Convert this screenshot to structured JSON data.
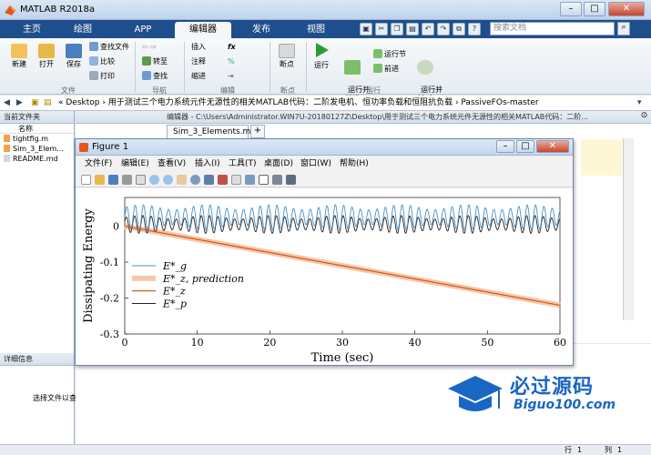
{
  "window": {
    "title": "MATLAB R2018a"
  },
  "tabs": [
    "主页",
    "绘图",
    "APP",
    "编辑器",
    "发布",
    "视图"
  ],
  "search": {
    "placeholder": "搜索文档"
  },
  "ribbon": {
    "file": {
      "new": "新建",
      "open": "打开",
      "save": "保存",
      "find_files": "查找文件",
      "compare": "比较",
      "print": "打印",
      "label": "文件"
    },
    "nav": {
      "goto": "转至",
      "find": "查找",
      "label": "导航"
    },
    "edit": {
      "insert": "插入",
      "comment": "注释",
      "indent": "缩进",
      "fx": "fx",
      "label": "编辑"
    },
    "breakpoints": {
      "label": "断点",
      "btn": "断点"
    },
    "run": {
      "run": "运行",
      "run_advance": "运行并\n前进",
      "run_section": "运行节",
      "advance": "前进",
      "run_time": "运行并\n计时",
      "label": "运行"
    }
  },
  "address": {
    "path": "« Desktop › 用于测试三个电力系统元件无源性的相关MATLAB代码：二阶发电机、恒功率负载和恒阻抗负载 › PassiveFOs-master"
  },
  "current_folder": {
    "title": "当前文件夹",
    "column": "名称",
    "files": [
      "tightfig.m",
      "Sim_3_Elem...",
      "README.md"
    ]
  },
  "details": {
    "title": "详细信息",
    "hint": "选择文件以查看详细信息"
  },
  "editor": {
    "header": "编辑器 - C:\\Users\\Administrator.WIN7U-20180127Z\\Desktop\\用于测试三个电力系统元件无源性的相关MATLAB代码：二阶...",
    "tab": "Sim_3_Elements.m",
    "add_tab": "+"
  },
  "status": {
    "row_label": "行",
    "row": "1",
    "col_label": "列",
    "col": "1"
  },
  "figure": {
    "title": "Figure 1",
    "menu": [
      "文件(F)",
      "编辑(E)",
      "查看(V)",
      "插入(I)",
      "工具(T)",
      "桌面(D)",
      "窗口(W)",
      "帮助(H)"
    ]
  },
  "chart_data": {
    "type": "line",
    "xlabel": "Time (sec)",
    "ylabel": "Dissipating Energy",
    "xlim": [
      0,
      60
    ],
    "ylim": [
      -0.3,
      0.08
    ],
    "xticks": [
      0,
      10,
      20,
      30,
      40,
      50,
      60
    ],
    "yticks": [
      0,
      -0.1,
      -0.2,
      -0.3
    ],
    "legend": [
      "E*_g",
      "E*_z, prediction",
      "E*_z",
      "E*_p"
    ],
    "legend_position": "bottom-left",
    "series": [
      {
        "name": "E*_g",
        "color": "#4a90c8",
        "description": "oscillating",
        "amplitude": 0.035,
        "center": 0.025,
        "period_sec": 1.15,
        "x": [
          0,
          60
        ],
        "y_range": [
          -0.04,
          0.08
        ]
      },
      {
        "name": "E*_z, prediction",
        "color": "#f4c9a8",
        "x": [
          0,
          60
        ],
        "y": [
          0,
          -0.22
        ]
      },
      {
        "name": "E*_z",
        "color": "#d95319",
        "x": [
          0,
          60
        ],
        "y": [
          0,
          -0.22
        ]
      },
      {
        "name": "E*_p",
        "color": "#222222",
        "description": "oscillating",
        "amplitude": 0.025,
        "center": 0.005,
        "period_sec": 1.15,
        "x": [
          0,
          60
        ],
        "y_range": [
          -0.02,
          0.045
        ]
      }
    ]
  },
  "watermark": {
    "title": "必过源码",
    "subtitle": "Biguo100.com"
  },
  "colors": {
    "accent": "#1e4f8c",
    "brand_blue": "#1a66c4"
  }
}
